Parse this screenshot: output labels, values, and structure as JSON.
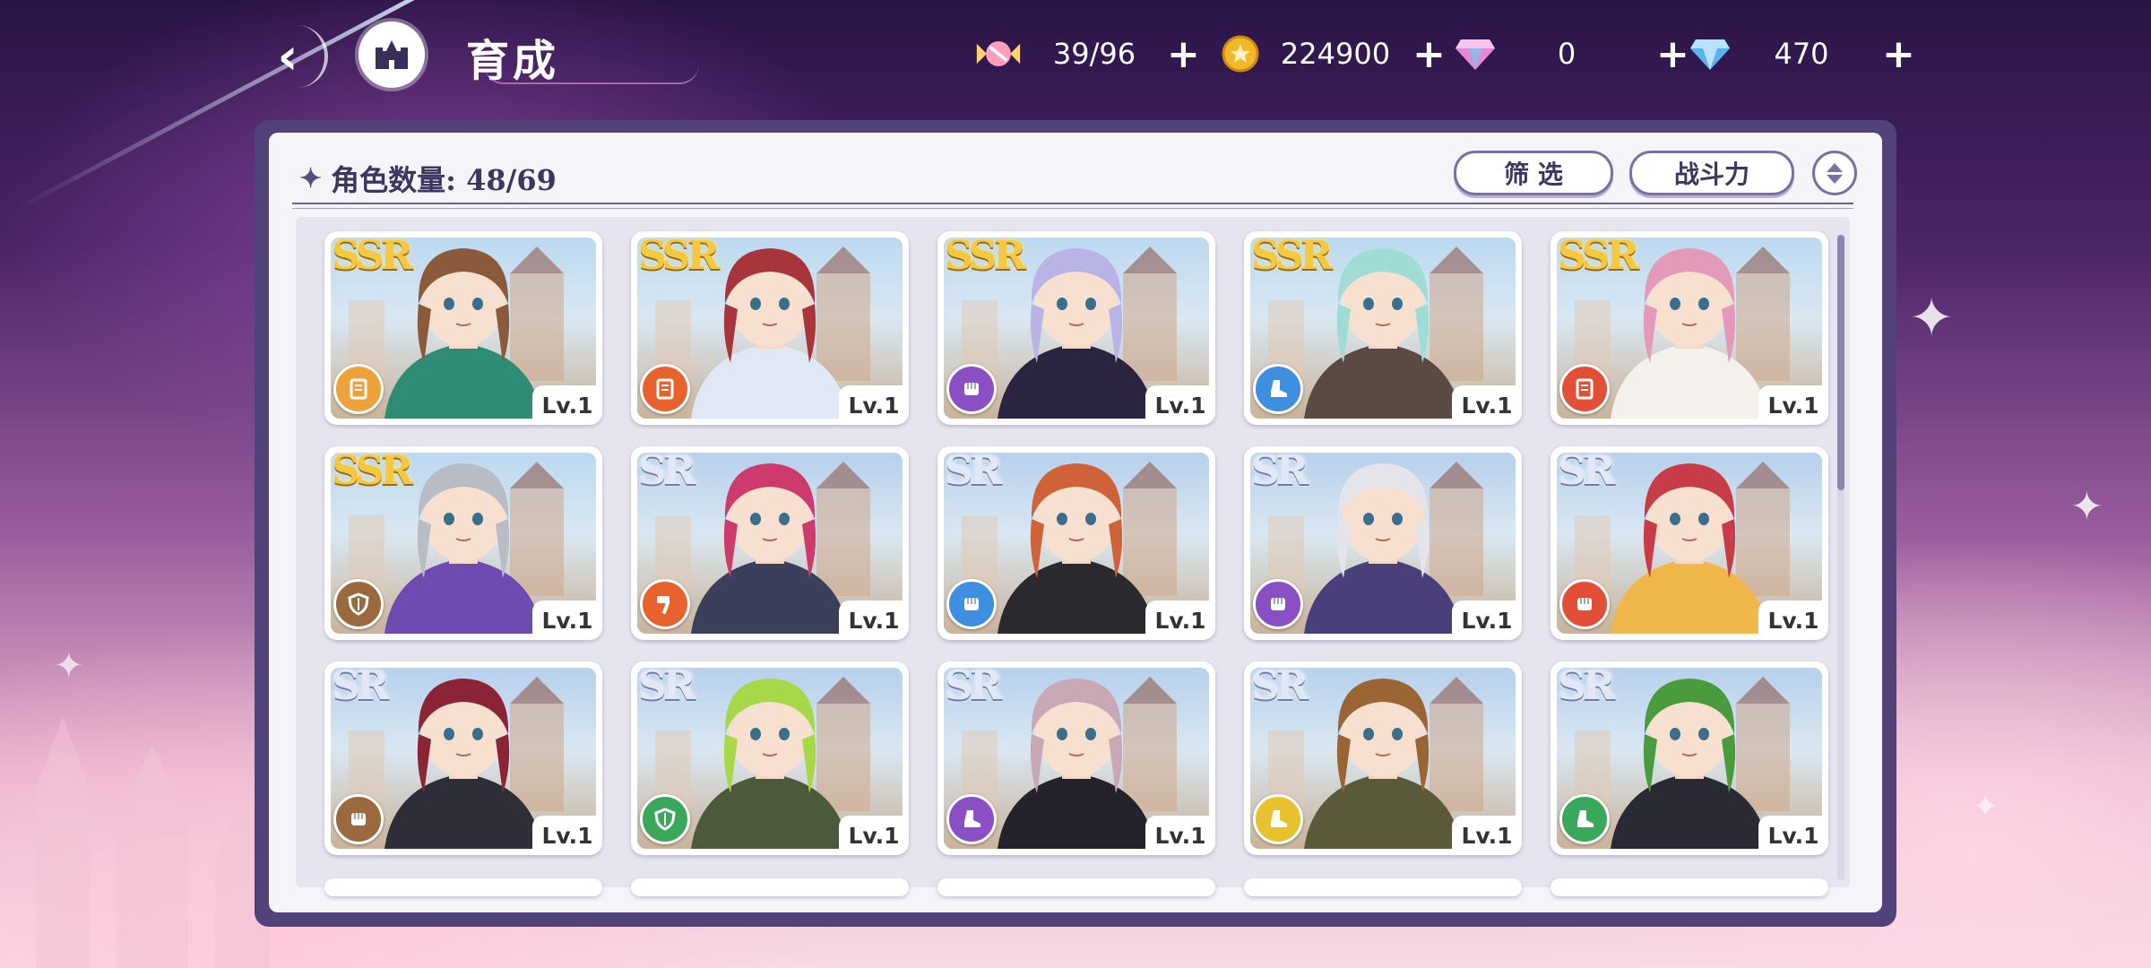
{
  "header": {
    "title": "育成",
    "resources": [
      {
        "icon": "candy-icon",
        "value": "39/96",
        "color": "#ffb6c8"
      },
      {
        "icon": "gold-coin-icon",
        "value": "224900",
        "color": "#f3b72a"
      },
      {
        "icon": "pink-gem-icon",
        "value": "0",
        "color": "#e787d6"
      },
      {
        "icon": "blue-diamond-icon",
        "value": "470",
        "color": "#7ecbf5"
      }
    ]
  },
  "panel": {
    "count_label": "角色数量: 48/69",
    "filter_label": "筛 选",
    "sort_label": "战斗力"
  },
  "characters": [
    {
      "rarity": "SSR",
      "level": "Lv.1",
      "role": "book",
      "role_color": "#f0a23a",
      "hair": "#8a5a3a",
      "outfit": "#2f8c74"
    },
    {
      "rarity": "SSR",
      "level": "Lv.1",
      "role": "book",
      "role_color": "#e8622e",
      "hair": "#a8343c",
      "outfit": "#dfe8f4"
    },
    {
      "rarity": "SSR",
      "level": "Lv.1",
      "role": "fist",
      "role_color": "#8a4fc2",
      "hair": "#b9b3e6",
      "outfit": "#2a2440"
    },
    {
      "rarity": "SSR",
      "level": "Lv.1",
      "role": "boot",
      "role_color": "#3f8fe0",
      "hair": "#9fdcd6",
      "outfit": "#5b4a44"
    },
    {
      "rarity": "SSR",
      "level": "Lv.1",
      "role": "book",
      "role_color": "#e24f36",
      "hair": "#e39ab8",
      "outfit": "#f4f1ec"
    },
    {
      "rarity": "SSR",
      "level": "Lv.1",
      "role": "shield",
      "role_color": "#9a6a3e",
      "hair": "#b8bcc4",
      "outfit": "#6e4bb0"
    },
    {
      "rarity": "SR",
      "level": "Lv.1",
      "role": "hammer",
      "role_color": "#e8622e",
      "hair": "#cc3b6b",
      "outfit": "#3a3f5c"
    },
    {
      "rarity": "SR",
      "level": "Lv.1",
      "role": "fist",
      "role_color": "#3f8fe0",
      "hair": "#d0623a",
      "outfit": "#2a2a2e"
    },
    {
      "rarity": "SR",
      "level": "Lv.1",
      "role": "fist",
      "role_color": "#8a4fc2",
      "hair": "#e4e4ea",
      "outfit": "#4a3f7a"
    },
    {
      "rarity": "SR",
      "level": "Lv.1",
      "role": "fist",
      "role_color": "#e24f36",
      "hair": "#c83c48",
      "outfit": "#f0b84a"
    },
    {
      "rarity": "SR",
      "level": "Lv.1",
      "role": "fist",
      "role_color": "#9a6a3e",
      "hair": "#8a2436",
      "outfit": "#2e2e38"
    },
    {
      "rarity": "SR",
      "level": "Lv.1",
      "role": "shield",
      "role_color": "#3aa85a",
      "hair": "#a6d84a",
      "outfit": "#4a5a3a"
    },
    {
      "rarity": "SR",
      "level": "Lv.1",
      "role": "boot",
      "role_color": "#8a4fc2",
      "hair": "#c8a8b4",
      "outfit": "#24222a"
    },
    {
      "rarity": "SR",
      "level": "Lv.1",
      "role": "boot",
      "role_color": "#e8c22e",
      "hair": "#9a6434",
      "outfit": "#5a5a3a"
    },
    {
      "rarity": "SR",
      "level": "Lv.1",
      "role": "boot",
      "role_color": "#3aa85a",
      "hair": "#4a9a3e",
      "outfit": "#2a2a34"
    }
  ]
}
